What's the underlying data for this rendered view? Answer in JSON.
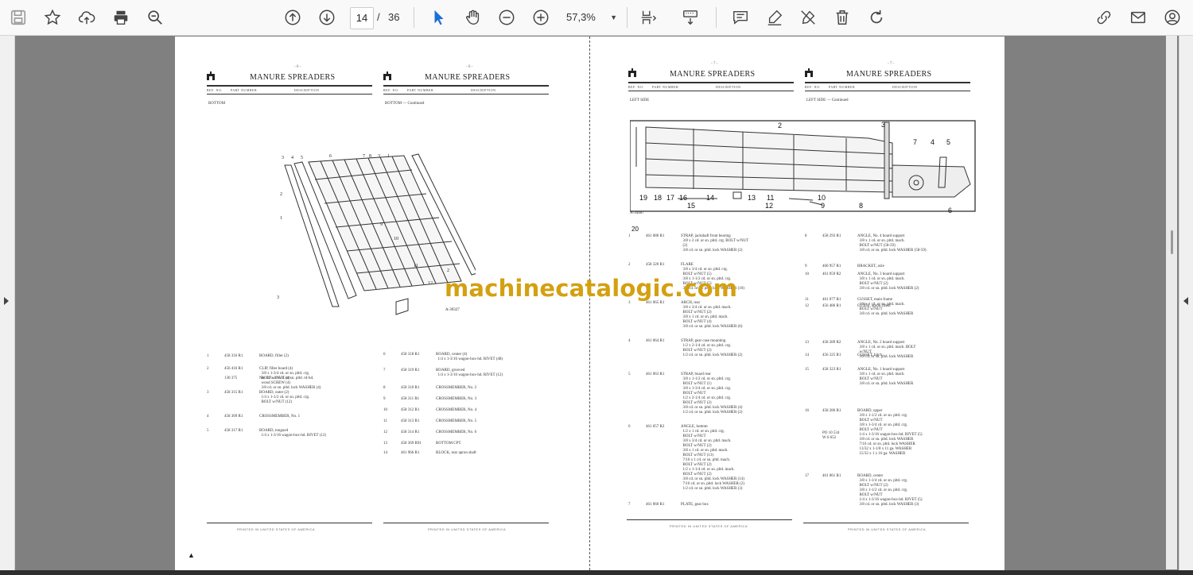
{
  "toolbar": {
    "page_current": "14",
    "page_separator": "/",
    "page_total": "36",
    "zoom_value": "57,3%",
    "icons": [
      "save-icon",
      "bookmark-star-icon",
      "upload-cloud-icon",
      "print-icon",
      "zoom-search-icon",
      "page-up-icon",
      "page-down-icon",
      "select-cursor-icon",
      "hand-pan-icon",
      "zoom-out-icon",
      "zoom-in-icon",
      "zoom-dropdown-icon",
      "page-fit-icon",
      "scroll-mode-icon",
      "comment-icon",
      "highlight-pen-icon",
      "sign-pen-icon",
      "delete-icon",
      "rotate-icon",
      "link-share-icon",
      "email-icon",
      "account-icon"
    ]
  },
  "watermark": "machinecatalogic.com",
  "document": {
    "pages": [
      {
        "page_number": "- 6 -",
        "title": "MANURE SPREADERS",
        "header_cols": [
          "REF. NO.",
          "PART NUMBER",
          "DESCRIPTION"
        ],
        "section": "BOTTOM",
        "figure_label": "A-39327",
        "rows": [
          {
            "ref": "1",
            "part": "458 316 R1",
            "desc": "BOARD, filler (2)"
          },
          {
            "ref": "2",
            "part": "456 416 R1",
            "desc": "CLIP, filler board (4)\n  3/8 x 1-3/4 cd. or sn. pltd. crg.\n  BOLT w/NUT (4)"
          },
          {
            "ref": "",
            "part": "130 375",
            "desc": "No. 10 x 3/4 cd. or sn. pltd. rd-hd.\n  wood SCREW (4)\n  3/8 cd. or sn. pltd. lock WASHER (4)"
          },
          {
            "ref": "3",
            "part": "458 315 R1",
            "desc": "BOARD, outer (2)\n  1/4 x 1-1/2 cd. or sn. pltd. crg.\n  BOLT w/NUT (12)"
          },
          {
            "ref": "4",
            "part": "458 309 R1",
            "desc": "CROSSMEMBER, No. 1"
          },
          {
            "ref": "5",
            "part": "458 317 R1",
            "desc": "BOARD, tongued\n  1/4 x 1-3/16 wagon-box-hd. RIVET (12)"
          }
        ],
        "footer": "PRINTED IN UNITED STATES OF AMERICA"
      },
      {
        "page_number": "- 6 -",
        "title": "MANURE SPREADERS",
        "header_cols": [
          "REF. NO.",
          "PART NUMBER",
          "DESCRIPTION"
        ],
        "section": "BOTTOM — Continued",
        "rows": [
          {
            "ref": "6",
            "part": "458 318 R1",
            "desc": "BOARD, center (4)\n  1/4 x 1-3/16 wagon-box-hd. RIVET (48)"
          },
          {
            "ref": "7",
            "part": "458 319 R1",
            "desc": "BOARD, grooved\n  1/4 x 1-3/16 wagon-box-hd. RIVET (12)"
          },
          {
            "ref": "8",
            "part": "458 310 R1",
            "desc": "CROSSMEMBER, No. 2"
          },
          {
            "ref": "9",
            "part": "458 311 R1",
            "desc": "CROSSMEMBER, No. 3"
          },
          {
            "ref": "10",
            "part": "458 312 R1",
            "desc": "CROSSMEMBER, No. 4"
          },
          {
            "ref": "11",
            "part": "458 313 R1",
            "desc": "CROSSMEMBER, No. 5"
          },
          {
            "ref": "12",
            "part": "458 314 R1",
            "desc": "CROSSMEMBER, No. 6"
          },
          {
            "ref": "13",
            "part": "458 369 R91",
            "desc": "BOTTOM CPT."
          },
          {
            "ref": "14",
            "part": "461 966 R1",
            "desc": "BLOCK, rear apron shaft"
          }
        ],
        "footer": "PRINTED IN UNITED STATES OF AMERICA"
      },
      {
        "page_number": "- 7 -",
        "title": "MANURE SPREADERS",
        "header_cols": [
          "REF. NO.",
          "PART NUMBER",
          "DESCRIPTION"
        ],
        "section": "LEFT SIDE",
        "figure_label": "A-34407",
        "rows": [
          {
            "ref": "1",
            "part": "461 080 R1",
            "desc": "STRAP, jackshaft front bearing\n  3/8 x 2 cd. or sn. pltd. crg. BOLT w/NUT\n  (2)\n  3/8 cd. or sn. pltd. lock WASHER (2)"
          },
          {
            "ref": "2",
            "part": "458 320 R1",
            "desc": "FLARE\n  3/8 x 3/4 cd. or sn. pltd. crg.\n  BOLT w/NUT (5)\n  3/8 x 1-1/2 cd. or sn. pltd. crg.\n  BOLT w/NUT (5)\n  3/8 cd. or sn. pltd. lock WASHER (10)"
          },
          {
            "ref": "3",
            "part": "461 065 R1",
            "desc": "ARCH, rear\n  3/8 x 3/4 cd. or sn. pltd. mach.\n  BOLT w/NUT (2)\n  3/8 x 1 cd. or sn. pltd. mach.\n  BOLT w/NUT (4)\n  3/8 cd. or sn. pltd. lock WASHER (6)"
          },
          {
            "ref": "4",
            "part": "461 064 R1",
            "desc": "STRAP, gear case mounting\n  1/2 x 2-1/4 cd. or sn. pltd. crg.\n  BOLT w/NUT (2)\n  1/2 cd. or sn. pltd. lock WASHER (2)"
          },
          {
            "ref": "5",
            "part": "461 063 R1",
            "desc": "STRAP, board rear\n  3/8 x 1-1/2 cd. or sn. pltd. crg.\n  BOLT w/NUT (1)\n  3/8 x 1-3/4 cd. or sn. pltd. crg.\n  BOLT w/NUT\n  1/2 x 2-1/4 cd. or sn. pltd. crg.\n  BOLT w/NUT (2)\n  3/8 cd. or sn. pltd. lock WASHER (4)\n  1/2 cd. or sn. pltd. lock WASHER (2)"
          },
          {
            "ref": "6",
            "part": "461 057 R2",
            "desc": "ANGLE, bottom\n  1/2 x 1 cd. or sn. pltd. crg.\n  BOLT w/NUT\n  3/8 x 3/4 cd. or sn. pltd. mach.\n  BOLT w/NUT (2)\n  3/8 x 1 cd. or sn. pltd. mach.\n  BOLT w/NUT (13)\n  7/16 x 1 cd. or sn. pltd. mach.\n  BOLT w/NUT (2)\n  1/2 x 1-1/4 cd. or sn. pltd. mach.\n  BOLT w/NUT (2)\n  3/8 cd. or sn. pltd. lock WASHER (14)\n  7/16 cd. or sn. pltd. lock WASHER (2)\n  1/2 cd. or sn. pltd. lock WASHER (3)"
          },
          {
            "ref": "7",
            "part": "461 060 R1",
            "desc": "PLATE, gear box"
          }
        ],
        "footer": "PRINTED IN UNITED STATES OF AMERICA"
      },
      {
        "page_number": "- 7 -",
        "title": "MANURE SPREADERS",
        "header_cols": [
          "REF. NO.",
          "PART NUMBER",
          "DESCRIPTION"
        ],
        "section": "LEFT SIDE — Continued",
        "rows": [
          {
            "ref": "8",
            "part": "458 293 R1",
            "desc": "ANGLE, No. 4 board support\n  3/8 x 1 cd. or sn. pltd. mach.\n  BOLT w/NUT (58-59)\n  3/8 cd. or sn. pltd. lock WASHER (58-59)"
          },
          {
            "ref": "9",
            "part": "460 957 R1",
            "desc": "BRACKET, axle"
          },
          {
            "ref": "10",
            "part": "461 059 R2",
            "desc": "ANGLE, No. 3 board support\n  3/8 x 1 cd. or sn. pltd. mach.\n  BOLT w/NUT (2)\n  3/8 cd. or sn. pltd. lock WASHER (2)"
          },
          {
            "ref": "11",
            "part": "461 077 R1",
            "desc": "GUSSET, main frame\n  3/8 x 1 cd. or sn. pltd. mach.\n  BOLT w/NUT\n  3/8 cd. or sn. pltd. lock WASHER"
          },
          {
            "ref": "12",
            "part": "456 486 R1",
            "desc": "GUIDE, apron chain"
          },
          {
            "ref": "13",
            "part": "458 289 R2",
            "desc": "ANGLE, No. 2 board support\n  3/8 x 1 cd. or sn. pltd. mach. BOLT\n  w/NUT\n  3/8 cd. or sn. pltd. lock WASHER"
          },
          {
            "ref": "14",
            "part": "456 325 R1",
            "desc": "GUSSET, hitch"
          },
          {
            "ref": "15",
            "part": "458 323 R1",
            "desc": "ANGLE, No. 1 board support\n  3/8 x 1 cd. or sn. pltd. mach.\n  BOLT w/NUT\n  3/8 cd. or sn. pltd. lock WASHER"
          },
          {
            "ref": "16",
            "part": "458 286 R1",
            "desc": "BOARD, upper\n  3/8 x 1-1/2 cd. or sn. pltd. crg.\n  BOLT w/NUT\n  3/8 x 1-3/4 cd. or sn. pltd. crg.\n  BOLT w/NUT\n  1/4 x 1-3/16 wagon-box-hd. RIVET (5)\n  3/8 cd. or sn. pltd. lock WASHER\n  7/16 cd. or sn. pltd. lock WASHER\n  13/32 x 1-1/8 x 11 ga. WASHER\n  15/32 x 1 x 16 ga. WASHER"
          },
          {
            "ref": "",
            "part": "PO 10 534\nW 6 652",
            "desc": ""
          },
          {
            "ref": "17",
            "part": "461 061 R1",
            "desc": "BOARD, center\n  3/8 x 1-1/4 cd. or sn. pltd. crg.\n  BOLT w/NUT (2)\n  3/8 x 1-1/2 cd. or sn. pltd. crg.\n  BOLT w/NUT\n  1/4 x 1-3/16 wagon-box-hd. RIVET (5)\n  3/8 cd. or sn. pltd. lock WASHER (3)"
          }
        ],
        "footer": "PRINTED IN UNITED STATES OF AMERICA"
      }
    ]
  }
}
